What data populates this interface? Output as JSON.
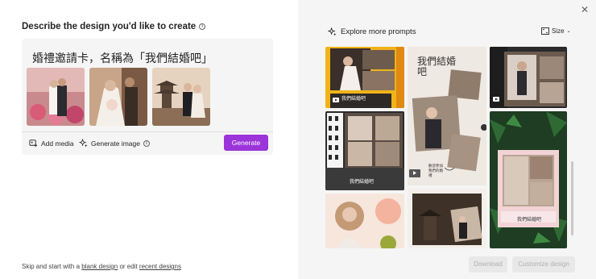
{
  "left": {
    "heading": "Describe the design you'd like to create",
    "prompt": "婚禮邀請卡，名稱為「我們結婚吧」",
    "add_media": "Add media",
    "generate_image": "Generate image",
    "generate_button": "Generate",
    "footer": {
      "prefix": "Skip and start with a",
      "blank_design": "blank design",
      "middle": "or edit",
      "recent_designs": "recent designs"
    }
  },
  "right": {
    "explore_title": "Explore more prompts",
    "size_label": "Size",
    "download_button": "Download",
    "customize_button": "Customize design",
    "tile_captions": {
      "t1": "我們結婚吧",
      "t4": "我們結婚吧",
      "t2_title": "我們結婚吧",
      "t2_note": "歡迎參加我們的婚禮",
      "t6": "我們結婚吧"
    }
  },
  "colors": {
    "accent": "#9b34d9",
    "panel_bg": "#f5f5f5",
    "prompt_bg": "#f5f5f5"
  }
}
